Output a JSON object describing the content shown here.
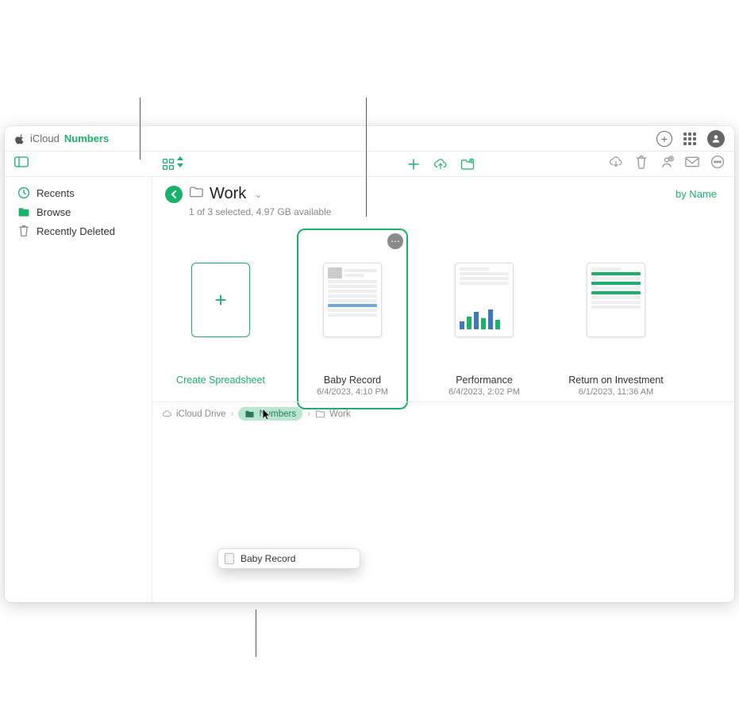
{
  "brand": {
    "prefix": "iCloud",
    "app": "Numbers"
  },
  "sidebar": {
    "items": [
      {
        "label": "Recents"
      },
      {
        "label": "Browse"
      },
      {
        "label": "Recently Deleted"
      }
    ]
  },
  "location": {
    "title": "Work",
    "status": "1 of 3 selected, 4.97 GB available",
    "sort_label": "by Name"
  },
  "tiles": {
    "create_label": "Create Spreadsheet",
    "items": [
      {
        "name": "Baby Record",
        "date": "6/4/2023, 4:10 PM"
      },
      {
        "name": "Performance",
        "date": "6/4/2023, 2:02 PM"
      },
      {
        "name": "Return on Investment",
        "date": "6/1/2023, 11:36 AM"
      }
    ]
  },
  "drag": {
    "label": "Baby Record"
  },
  "path": {
    "root": "iCloud Drive",
    "mid": "Numbers",
    "leaf": "Work"
  },
  "colors": {
    "accent": "#1ab26a"
  }
}
